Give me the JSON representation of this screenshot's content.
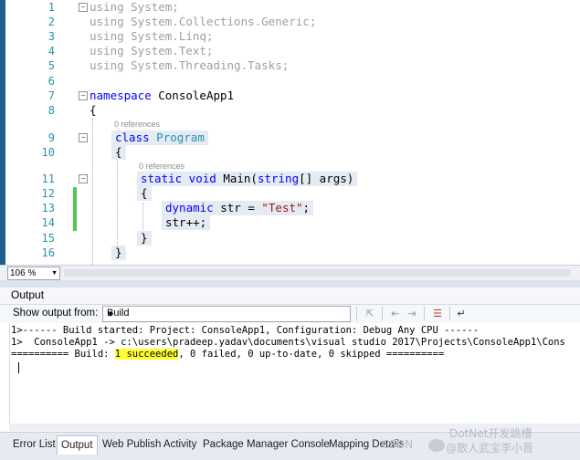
{
  "editor": {
    "lines": [
      {
        "num": "1",
        "text": "using System;"
      },
      {
        "num": "2",
        "text": "using System.Collections.Generic;"
      },
      {
        "num": "3",
        "text": "using System.Linq;"
      },
      {
        "num": "4",
        "text": "using System.Text;"
      },
      {
        "num": "5",
        "text": "using System.Threading.Tasks;"
      },
      {
        "num": "6",
        "text": ""
      },
      {
        "num": "7",
        "kw": "namespace",
        "rest": " ConsoleApp1"
      },
      {
        "num": "8",
        "text": "{"
      },
      {
        "num": "9",
        "kw": "class",
        "type": "Program"
      },
      {
        "num": "10",
        "text": "{"
      },
      {
        "num": "11",
        "kw": "static void",
        "rest": " Main(",
        "kw2": "string",
        "rest2": "[] args)"
      },
      {
        "num": "12",
        "text": "{"
      },
      {
        "num": "13",
        "kw": "dynamic",
        "rest": " str = ",
        "str": "\"Test\"",
        "rest2": ";"
      },
      {
        "num": "14",
        "text": "str++;"
      },
      {
        "num": "15",
        "text": "}"
      },
      {
        "num": "16",
        "text": "}"
      }
    ],
    "references_class": "0 references",
    "references_main": "0 references",
    "zoom": "106 %"
  },
  "output": {
    "title": "Output",
    "show_from_label": "Show output from:",
    "source": "Build",
    "lines": [
      "1>------ Build started: Project: ConsoleApp1, Configuration: Debug Any CPU ------",
      "1>  ConsoleApp1 -> c:\\users\\pradeep.yadav\\documents\\visual studio 2017\\Projects\\ConsoleApp1\\Cons"
    ],
    "summary_prefix": "========== Build: ",
    "summary_highlight": "1 succeeded",
    "summary_suffix": ", 0 failed, 0 up-to-date, 0 skipped =========="
  },
  "tabs": [
    {
      "label": "Error List",
      "active": false
    },
    {
      "label": "Output",
      "active": true
    },
    {
      "label": "Web Publish Activity",
      "active": false
    },
    {
      "label": "Package Manager Console",
      "active": false
    },
    {
      "label": "Mapping Details",
      "active": false
    }
  ],
  "watermark": {
    "csdn": "CSDN",
    "brand": "DotNet开发跳槽",
    "author": "@散人武宝李小晋"
  },
  "icons": [
    "fold-minus-icon",
    "dropdown-arrow-icon",
    "find-message-icon",
    "prev-message-icon",
    "next-message-icon",
    "clear-all-icon",
    "word-wrap-icon"
  ]
}
